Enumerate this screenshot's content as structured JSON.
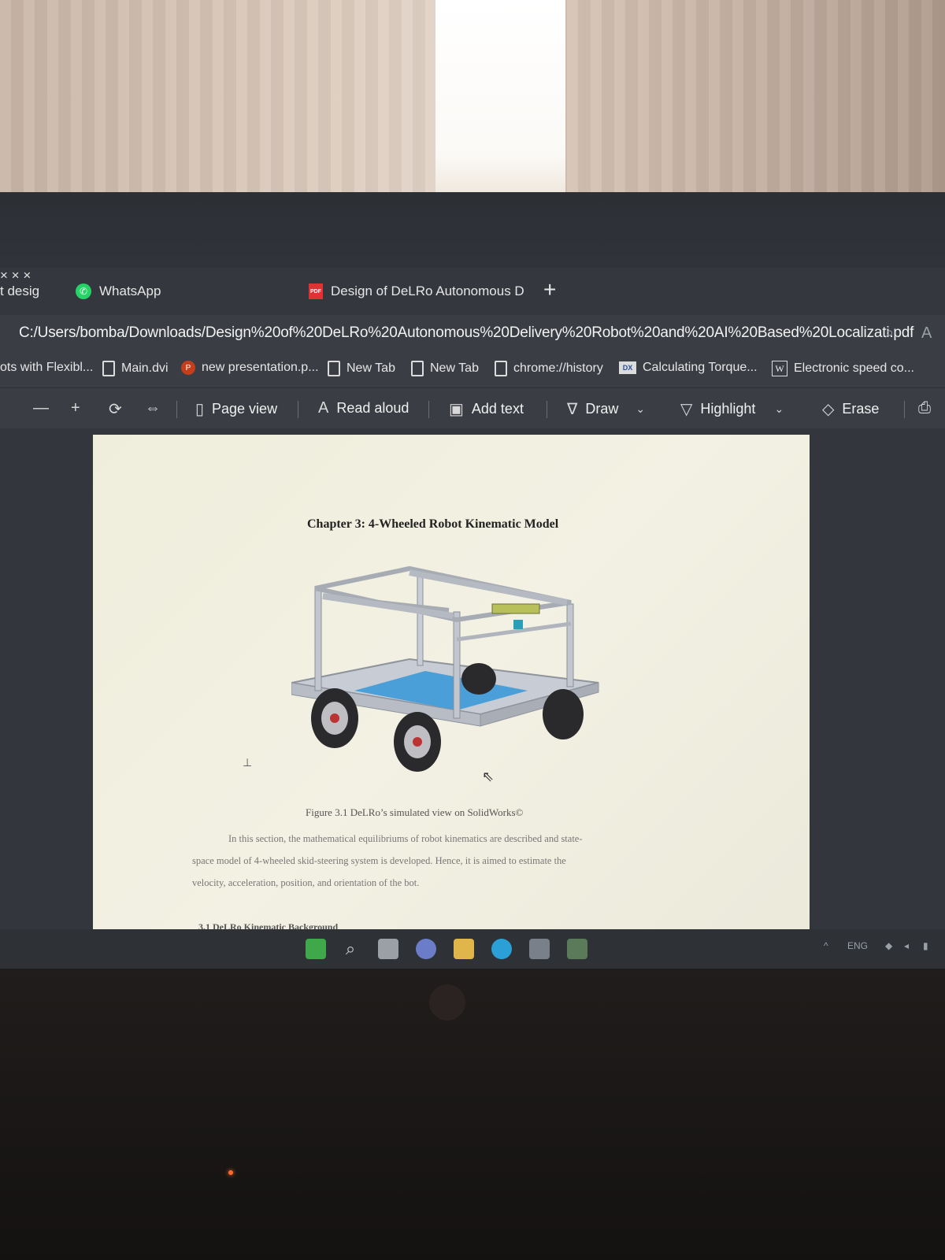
{
  "tabs": [
    {
      "label": "t desig",
      "icon": "tab-icon"
    },
    {
      "label": "WhatsApp",
      "icon": "whatsapp-icon"
    },
    {
      "label": "Design of DeLRo Autonomous D",
      "icon": "pdf-icon"
    }
  ],
  "address": {
    "url": "C:/Users/bomba/Downloads/Design%20of%20DeLRo%20Autonomous%20Delivery%20Robot%20and%20AI%20Based%20Localizati.pdf"
  },
  "bookmarks": [
    {
      "label": "ots with Flexibl...",
      "icon": "none"
    },
    {
      "label": "Main.dvi",
      "icon": "page-icon"
    },
    {
      "label": "new presentation.p...",
      "icon": "powerpoint-icon"
    },
    {
      "label": "New Tab",
      "icon": "page-icon"
    },
    {
      "label": "New Tab",
      "icon": "page-icon"
    },
    {
      "label": "chrome://history",
      "icon": "page-icon"
    },
    {
      "label": "Calculating Torque...",
      "icon": "dx-icon"
    },
    {
      "label": "Electronic speed co...",
      "icon": "w-icon"
    }
  ],
  "pdf_toolbar": {
    "page_view": "Page view",
    "read_aloud": "Read aloud",
    "add_text": "Add text",
    "draw": "Draw",
    "highlight": "Highlight",
    "erase": "Erase"
  },
  "document": {
    "chapter_title": "Chapter 3: 4-Wheeled Robot Kinematic Model",
    "figure_caption": "Figure 3.1 DeLRo’s simulated view on SolidWorks©",
    "paragraph": [
      "In this section, the mathematical equilibriums of robot kinematics are described and state-",
      "space model of 4-wheeled skid-steering system is developed. Hence, it is aimed to estimate the",
      "velocity, acceleration, position, and orientation of the bot."
    ],
    "section_heading": "3.1 DeLRo Kinematic Background"
  },
  "taskbar": {
    "tray_language": "ENG"
  },
  "colors": {
    "browser_bg": "#3a3d44",
    "page_bg": "#efeddb",
    "robot_frame": "#c7cad3",
    "robot_platform": "#4a9fd8"
  }
}
